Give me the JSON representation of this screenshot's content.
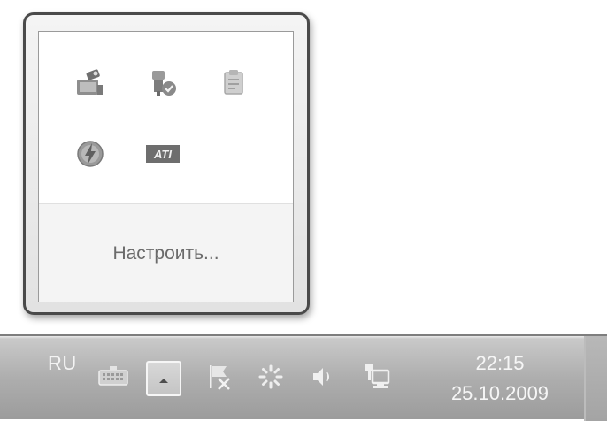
{
  "overflow_popup": {
    "icons": [
      {
        "name": "network-camera-icon"
      },
      {
        "name": "security-shield-icon"
      },
      {
        "name": "clipboard-icon"
      },
      {
        "name": "power-icon"
      },
      {
        "name": "ati-icon",
        "text": "ATI"
      }
    ],
    "customize_label": "Настроить..."
  },
  "taskbar": {
    "language": "RU",
    "clock": {
      "time": "22:15",
      "date": "25.10.2009"
    },
    "icons": [
      {
        "name": "keyboard-icon"
      },
      {
        "name": "show-hidden-icons-arrow-icon"
      },
      {
        "name": "action-center-flag-icon"
      },
      {
        "name": "loading-spinner-icon"
      },
      {
        "name": "volume-icon"
      },
      {
        "name": "network-icon"
      }
    ]
  }
}
